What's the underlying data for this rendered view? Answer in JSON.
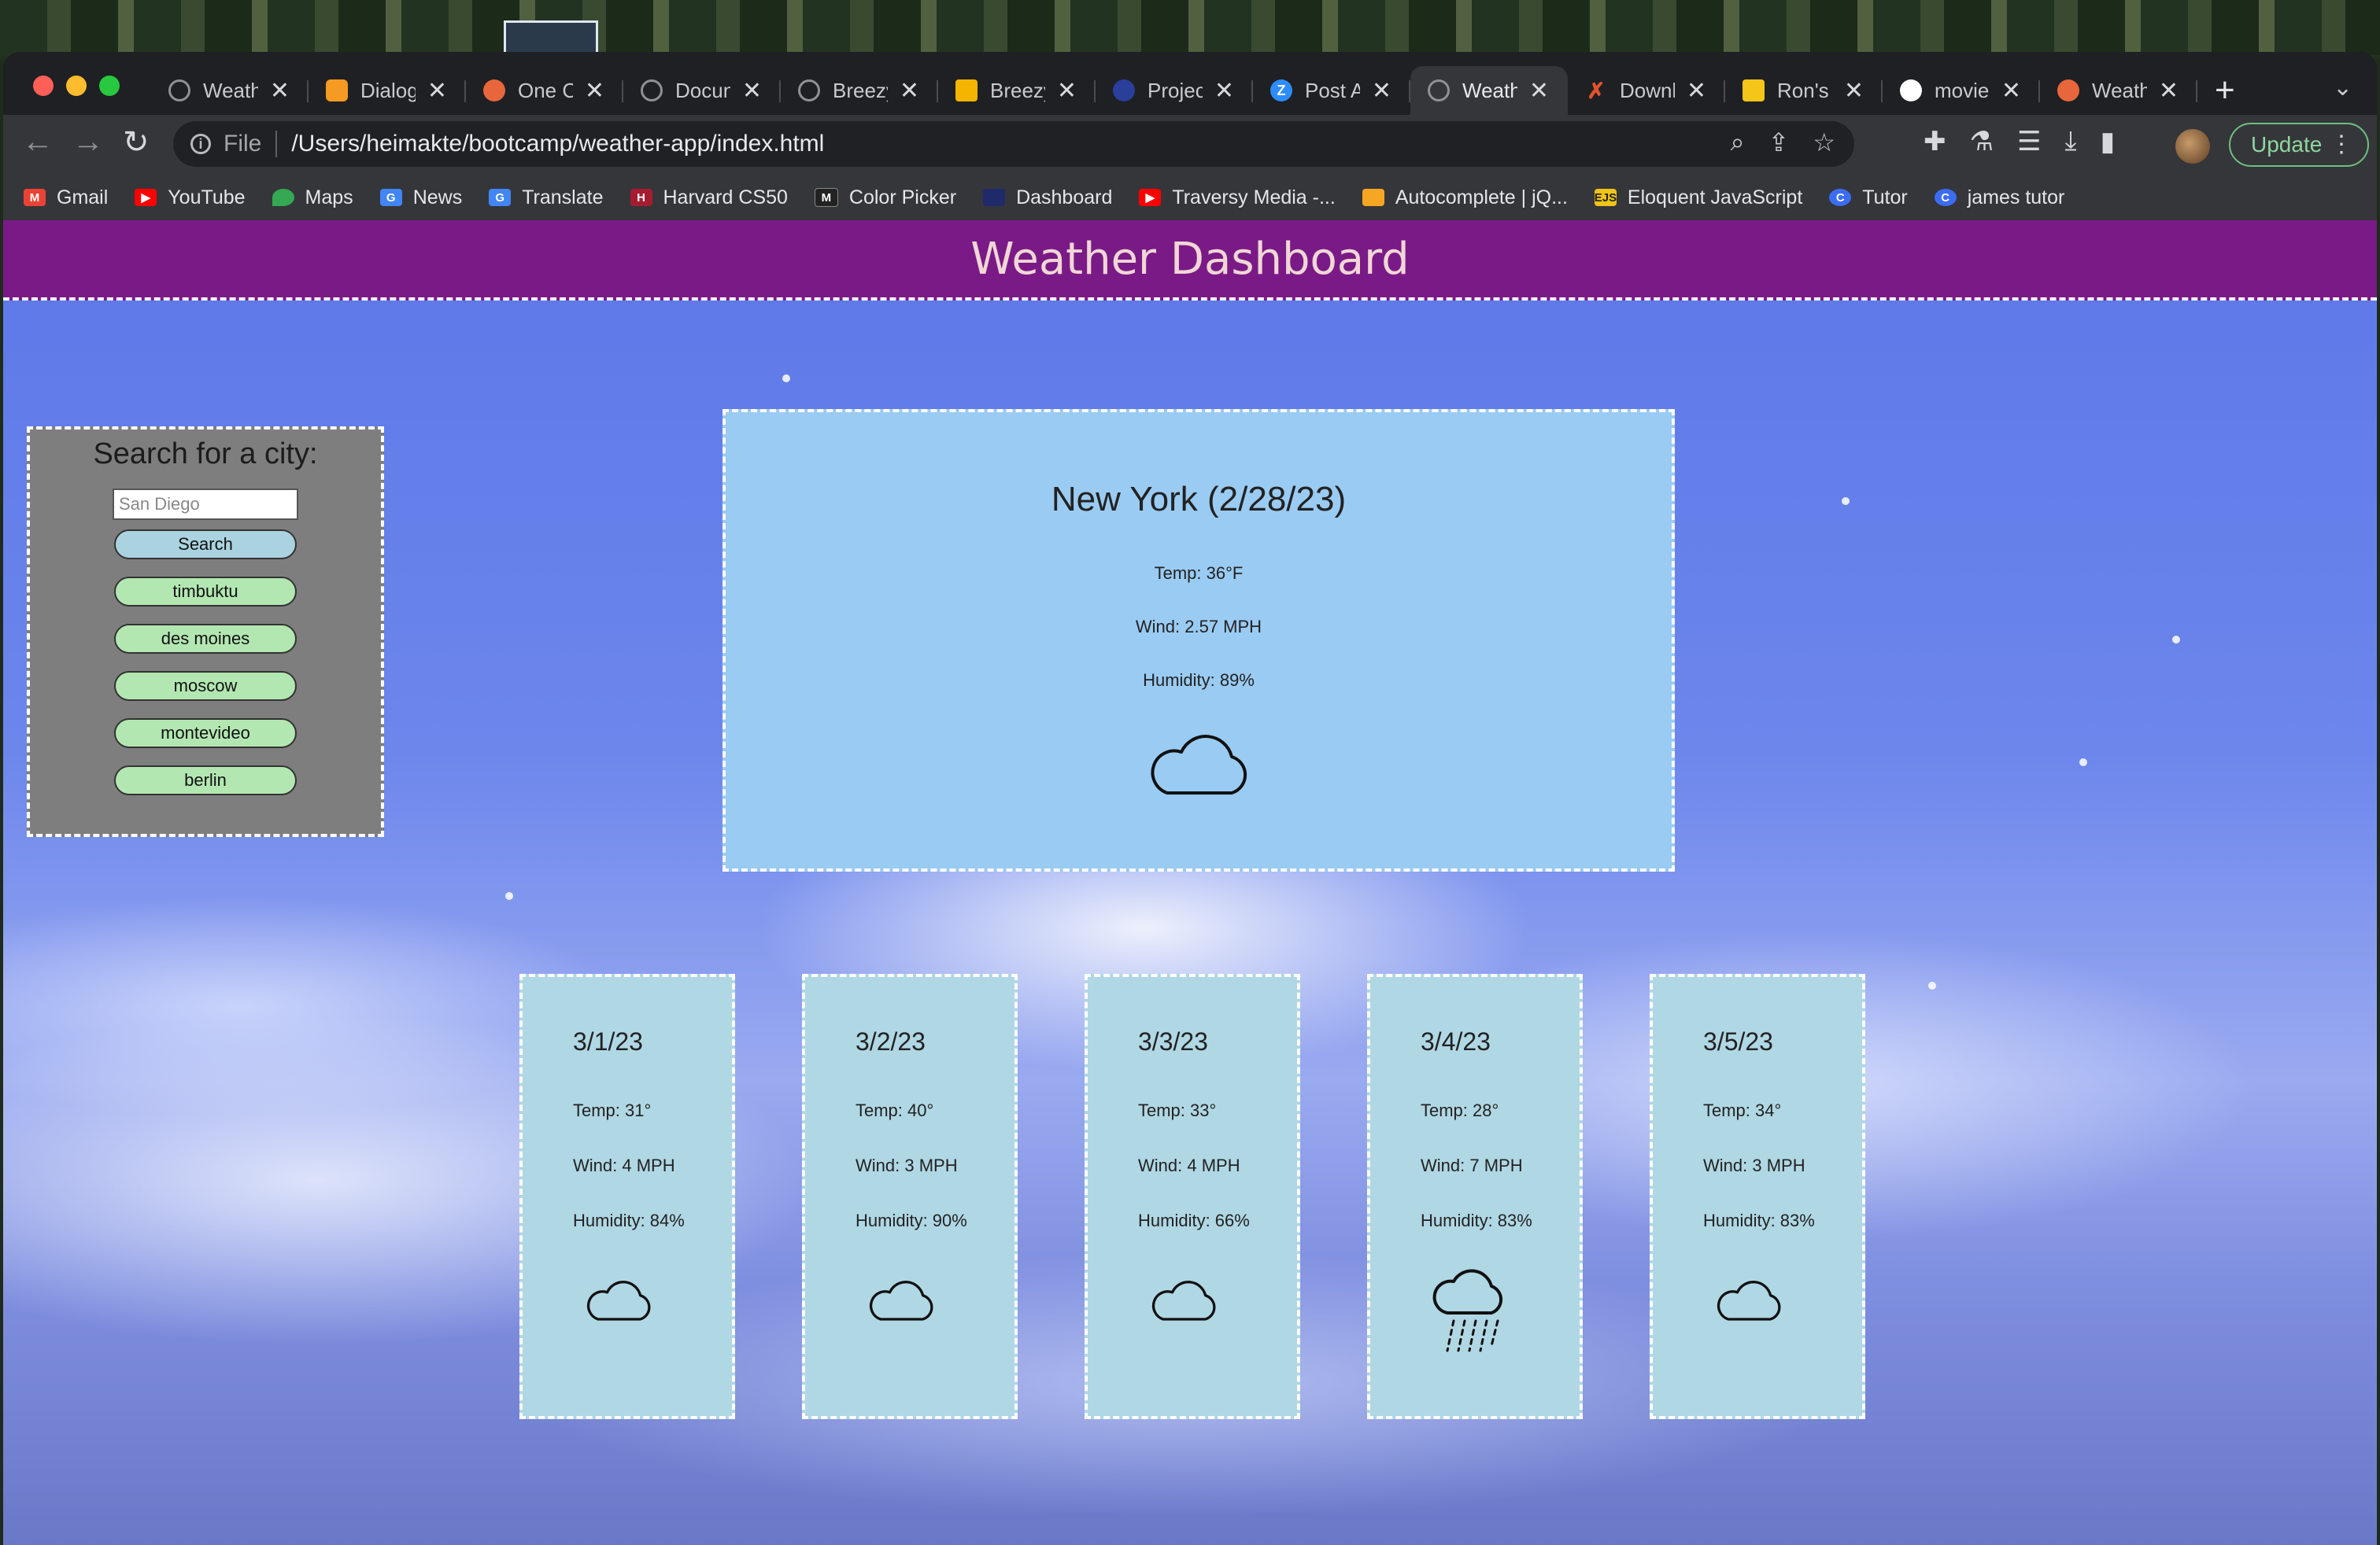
{
  "browser": {
    "tabs": [
      {
        "label": "Weath",
        "icon": "globe-icon",
        "color": "#8e9197"
      },
      {
        "label": "Dialog",
        "icon": "dialogflow-icon",
        "color": "#f59a23"
      },
      {
        "label": "One C",
        "icon": "postman-icon",
        "color": "#e8663c"
      },
      {
        "label": "Docun",
        "icon": "globe-icon",
        "color": "#8e9197"
      },
      {
        "label": "Breezy",
        "icon": "globe-icon",
        "color": "#8e9197"
      },
      {
        "label": "Breezy",
        "icon": "slides-icon",
        "color": "#f4b400"
      },
      {
        "label": "Projec",
        "icon": "project-icon",
        "color": "#2a3f9a"
      },
      {
        "label": "Post A",
        "icon": "zoom-icon",
        "color": "#2d8cff"
      },
      {
        "label": "Weath",
        "icon": "globe-icon",
        "color": "#8e9197",
        "active": true
      },
      {
        "label": "Downl",
        "icon": "x-logo-icon",
        "color": "#e2532c"
      },
      {
        "label": "Ron's",
        "icon": "imdb-icon",
        "color": "#f5c518"
      },
      {
        "label": "movie",
        "icon": "github-icon",
        "color": "#ffffff"
      },
      {
        "label": "Weath",
        "icon": "postman-icon",
        "color": "#e8663c"
      }
    ],
    "address": {
      "scheme": "File",
      "url": "/Users/heimakte/bootcamp/weather-app/index.html"
    },
    "update_label": "Update",
    "bookmarks": [
      {
        "label": "Gmail",
        "icon": "gmail-icon",
        "color": "#ea4335"
      },
      {
        "label": "YouTube",
        "icon": "youtube-icon",
        "color": "#ff0000"
      },
      {
        "label": "Maps",
        "icon": "maps-icon",
        "color": "#34a853"
      },
      {
        "label": "News",
        "icon": "news-icon",
        "color": "#4285f4"
      },
      {
        "label": "Translate",
        "icon": "translate-icon",
        "color": "#4285f4"
      },
      {
        "label": "Harvard CS50",
        "icon": "harvard-icon",
        "color": "#a51c30"
      },
      {
        "label": "Color Picker",
        "icon": "colorpicker-icon",
        "color": "#222222"
      },
      {
        "label": "Dashboard",
        "icon": "dashboard-icon",
        "color": "#1f2a6b"
      },
      {
        "label": "Traversy Media -...",
        "icon": "youtube-icon",
        "color": "#ff0000"
      },
      {
        "label": "Autocomplete | jQ...",
        "icon": "jquery-icon",
        "color": "#f5a623"
      },
      {
        "label": "Eloquent JavaScript",
        "icon": "ejs-icon",
        "color": "#f0c419"
      },
      {
        "label": "Tutor",
        "icon": "tutor-icon",
        "color": "#3b6df2"
      },
      {
        "label": "james tutor",
        "icon": "tutor-icon",
        "color": "#3b6df2"
      }
    ]
  },
  "app": {
    "title": "Weather Dashboard",
    "search": {
      "heading": "Search for a city:",
      "input_value": "",
      "input_placeholder": "San Diego",
      "button_label": "Search",
      "history": [
        "timbuktu",
        "des moines",
        "moscow",
        "montevideo",
        "berlin"
      ]
    },
    "current": {
      "title": "New York (2/28/23)",
      "temp": "Temp: 36°F",
      "wind": "Wind: 2.57 MPH",
      "humidity": "Humidity: 89%",
      "icon": "cloud-icon"
    },
    "forecast": [
      {
        "date": "3/1/23",
        "temp": "Temp: 31°",
        "wind": "Wind: 4 MPH",
        "humidity": "Humidity: 84%",
        "icon": "cloud-icon"
      },
      {
        "date": "3/2/23",
        "temp": "Temp: 40°",
        "wind": "Wind: 3 MPH",
        "humidity": "Humidity: 90%",
        "icon": "cloud-icon"
      },
      {
        "date": "3/3/23",
        "temp": "Temp: 33°",
        "wind": "Wind: 4 MPH",
        "humidity": "Humidity: 66%",
        "icon": "cloud-icon"
      },
      {
        "date": "3/4/23",
        "temp": "Temp: 28°",
        "wind": "Wind: 7 MPH",
        "humidity": "Humidity: 83%",
        "icon": "rain-cloud-icon"
      },
      {
        "date": "3/5/23",
        "temp": "Temp: 34°",
        "wind": "Wind: 3 MPH",
        "humidity": "Humidity: 83%",
        "icon": "cloud-icon"
      }
    ]
  },
  "colors": {
    "header_bg": "#7a1a86",
    "header_text": "#f0d7d6",
    "search_panel_bg": "#7e7e7e",
    "current_card_bg": "#9acbf2",
    "forecast_card_bg": "#b0d7e4",
    "search_button": "#aad3df",
    "history_button": "#b3e7b2"
  }
}
